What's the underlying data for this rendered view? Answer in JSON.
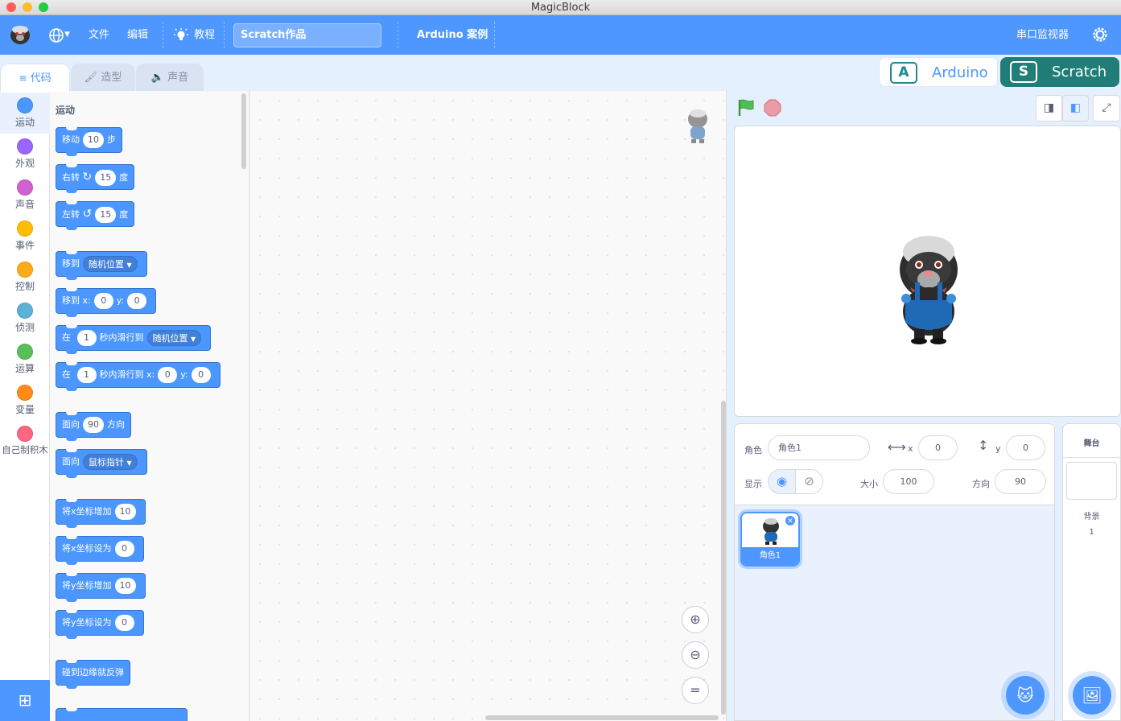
{
  "window": {
    "title": "MagicBlock"
  },
  "menu": {
    "file": "文件",
    "edit": "编辑",
    "tutorial": "教程",
    "project_title": "Scratch作品",
    "arduino_examples": "Arduino 案例",
    "serial_monitor": "串口监视器"
  },
  "tabs": [
    {
      "label": "代码"
    },
    {
      "label": "造型"
    },
    {
      "label": "声音"
    }
  ],
  "modes": {
    "arduino": "Arduino",
    "scratch": "Scratch"
  },
  "categories": [
    {
      "label": "运动",
      "color": "#4c97ff"
    },
    {
      "label": "外观",
      "color": "#9966ff"
    },
    {
      "label": "声音",
      "color": "#cf63cf"
    },
    {
      "label": "事件",
      "color": "#ffbf00"
    },
    {
      "label": "控制",
      "color": "#ffab19"
    },
    {
      "label": "侦测",
      "color": "#5cb1d6"
    },
    {
      "label": "运算",
      "color": "#59c059"
    },
    {
      "label": "变量",
      "color": "#ff8c1a"
    },
    {
      "label": "自己制积木",
      "color": "#ff6680"
    }
  ],
  "palette": {
    "heading": "运动",
    "blocks": {
      "move": {
        "a": "移动",
        "v": "10",
        "b": "步"
      },
      "turn_right": {
        "a": "右转",
        "v": "15",
        "b": "度"
      },
      "turn_left": {
        "a": "左转",
        "v": "15",
        "b": "度"
      },
      "goto": {
        "a": "移到",
        "d": "随机位置"
      },
      "goto_xy": {
        "a": "移到 x:",
        "x": "0",
        "yl": "y:",
        "y": "0"
      },
      "glide": {
        "a": "在",
        "v": "1",
        "b": "秒内滑行到",
        "d": "随机位置"
      },
      "glide_xy": {
        "a": "在",
        "v": "1",
        "b": "秒内滑行到 x:",
        "x": "0",
        "yl": "y:",
        "y": "0"
      },
      "point_dir": {
        "a": "面向",
        "v": "90",
        "b": "方向"
      },
      "point_towards": {
        "a": "面向",
        "d": "鼠标指针"
      },
      "change_x": {
        "a": "将x坐标增加",
        "v": "10"
      },
      "set_x": {
        "a": "将x坐标设为",
        "v": "0"
      },
      "change_y": {
        "a": "将y坐标增加",
        "v": "10"
      },
      "set_y": {
        "a": "将y坐标设为",
        "v": "0"
      },
      "bounce": {
        "a": "碰到边缘就反弹"
      }
    }
  },
  "sprite_info": {
    "sprite_label": "角色",
    "sprite_name": "角色1",
    "x_label": "x",
    "x": "0",
    "y_label": "y",
    "y": "0",
    "show_label": "显示",
    "size_label": "大小",
    "size": "100",
    "direction_label": "方向",
    "direction": "90"
  },
  "sprites": [
    {
      "name": "角色1"
    }
  ],
  "stage_panel": {
    "title": "舞台",
    "backdrop_label": "背景",
    "backdrop_count": "1"
  }
}
